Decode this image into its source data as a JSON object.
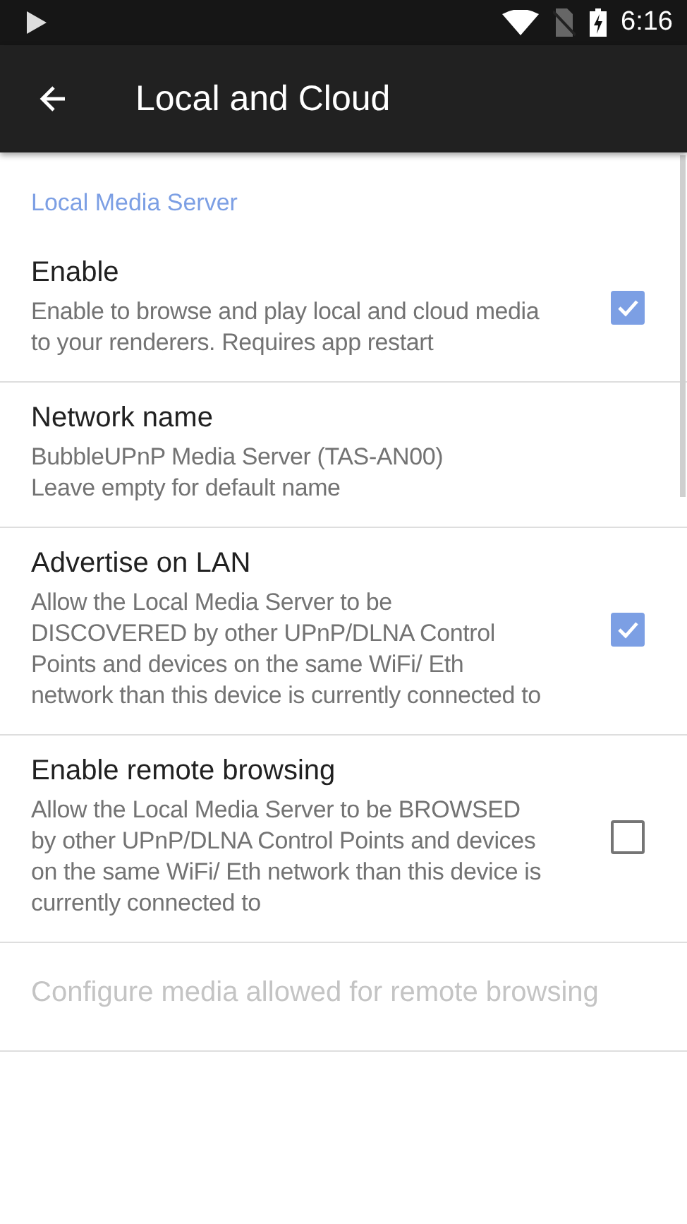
{
  "status_bar": {
    "time": "6:16"
  },
  "toolbar": {
    "title": "Local and Cloud"
  },
  "category": {
    "title": "Local Media Server"
  },
  "preferences": [
    {
      "kind": "checkbox",
      "title": "Enable",
      "summary": "Enable to browse and play local and cloud media to your renderers. Requires app restart",
      "checked": true,
      "disabled": false
    },
    {
      "kind": "text",
      "title": "Network name",
      "summary": "BubbleUPnP Media Server (TAS-AN00)\nLeave empty for default name",
      "disabled": false
    },
    {
      "kind": "checkbox",
      "title": "Advertise on LAN",
      "summary": "Allow the Local Media Server to be DISCOVERED by other UPnP/DLNA Control Points and devices on the same WiFi/ Eth network than this device is currently connected to",
      "checked": true,
      "disabled": false
    },
    {
      "kind": "checkbox",
      "title": "Enable remote browsing",
      "summary": "Allow the Local Media Server to be BROWSED by other UPnP/DLNA Control Points and devices on the same WiFi/ Eth network than this device is currently connected to",
      "checked": false,
      "disabled": false
    },
    {
      "kind": "text",
      "title": "Configure media allowed for remote browsing",
      "disabled": true
    }
  ]
}
